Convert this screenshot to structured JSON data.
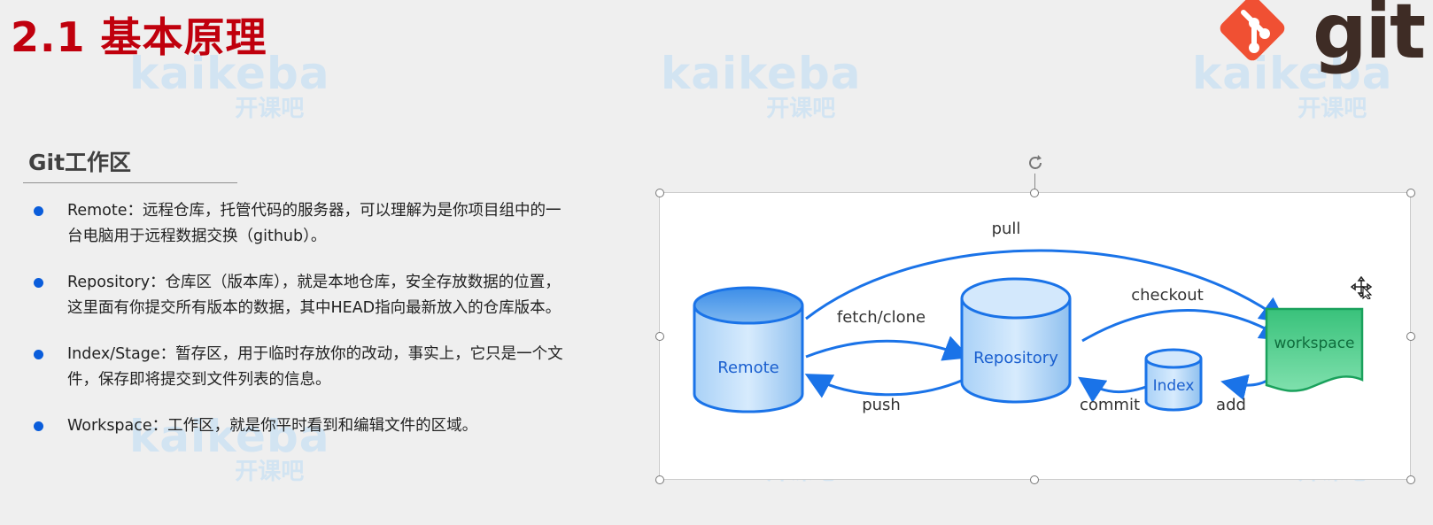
{
  "slide": {
    "title": "2.1 基本原理",
    "watermark": {
      "brand": "kaikeba",
      "cn": "开课吧"
    },
    "logo": {
      "word": "git",
      "brand_color": "#f05033"
    },
    "section": {
      "heading": "Git工作区",
      "items": [
        {
          "text": "Remote：远程仓库，托管代码的服务器，可以理解为是你项目组中的一台电脑用于远程数据交换（github）。"
        },
        {
          "text": "Repository：仓库区（版本库），就是本地仓库，安全存放数据的位置，这里面有你提交所有版本的数据，其中HEAD指向最新放入的仓库版本。"
        },
        {
          "text": "Index/Stage：暂存区，用于临时存放你的改动，事实上，它只是一个文件，保存即将提交到文件列表的信息。"
        },
        {
          "text": "Workspace：工作区，就是你平时看到和编辑文件的区域。"
        }
      ]
    },
    "diagram": {
      "nodes": {
        "remote": "Remote",
        "repository": "Repository",
        "index": "Index",
        "workspace": "workspace"
      },
      "edges": {
        "pull": "pull",
        "fetch_clone": "fetch/clone",
        "push": "push",
        "checkout": "checkout",
        "commit": "commit",
        "add": "add"
      },
      "colors": {
        "arrow": "#1a73e8",
        "cylinder": "#7fb8f0",
        "workspace": "#3cc07a",
        "title": "#c0000d"
      }
    }
  }
}
